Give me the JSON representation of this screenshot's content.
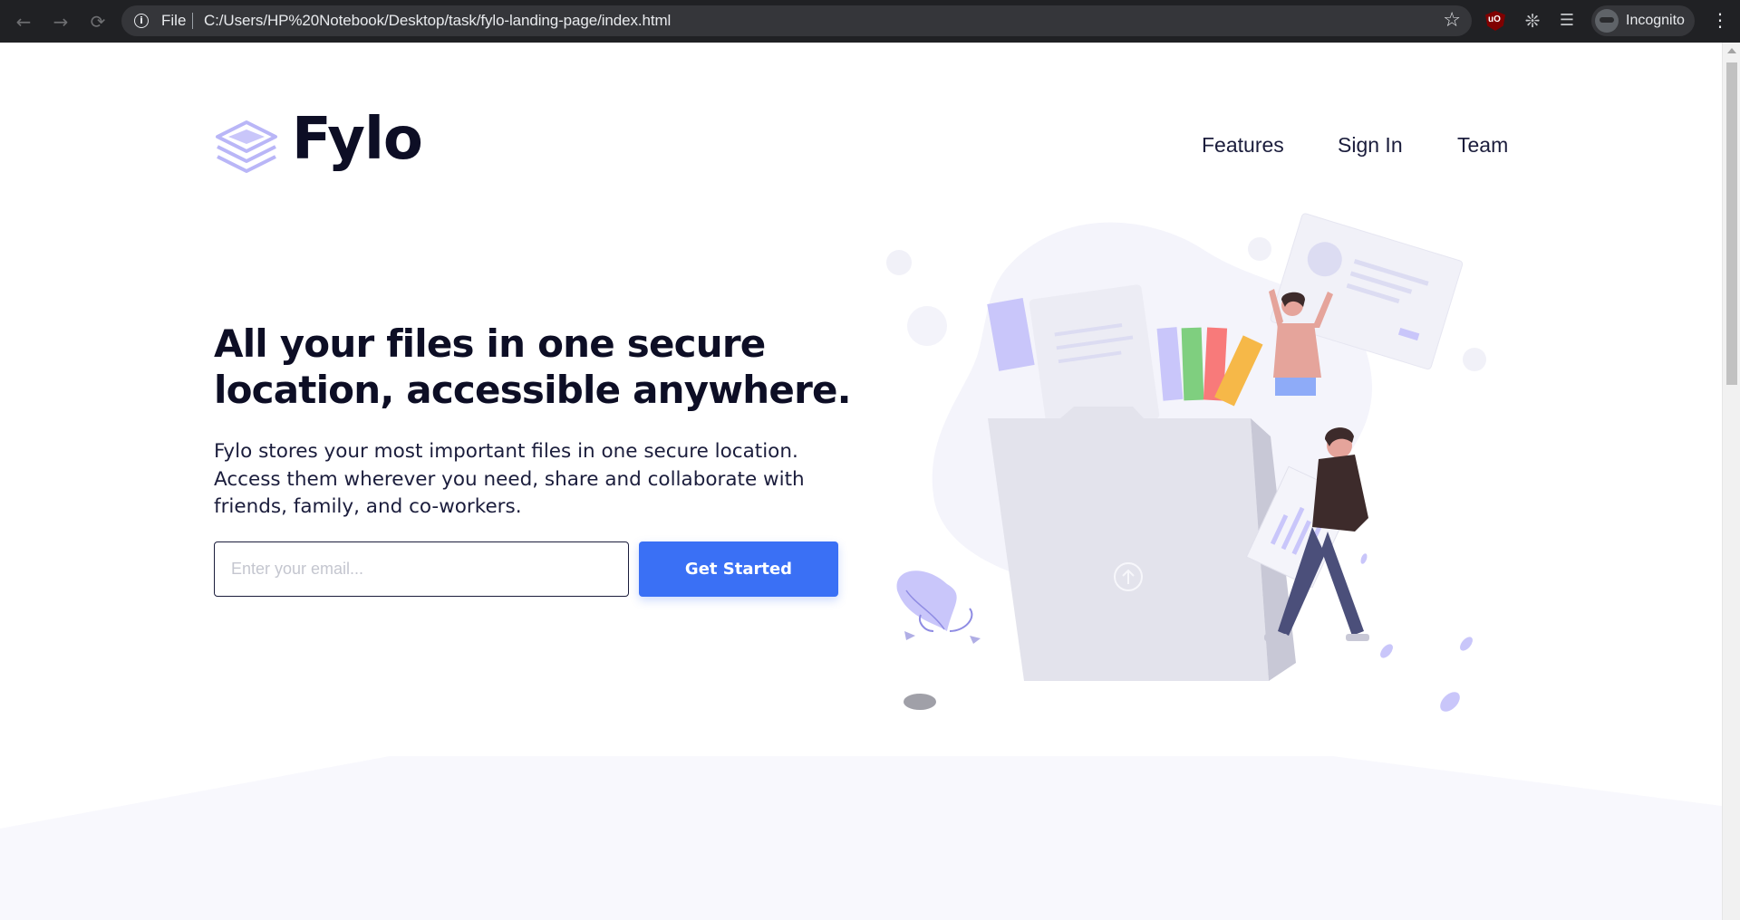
{
  "browser": {
    "file_label": "File",
    "url": "C:/Users/HP%20Notebook/Desktop/task/fylo-landing-page/index.html",
    "profile_label": "Incognito",
    "icons": [
      "back-icon",
      "forward-icon",
      "reload-icon",
      "info-icon",
      "star-icon",
      "ublock-icon",
      "puzzle-icon",
      "media-icon",
      "incognito-icon",
      "kebab-icon"
    ]
  },
  "header": {
    "logo_text": "Fylo",
    "nav": [
      "Features",
      "Sign In",
      "Team"
    ]
  },
  "hero": {
    "headline_line1": "All your files in one secure",
    "headline_line2": "location, accessible anywhere.",
    "body": "Fylo stores your most important files in one secure location. Access them wherever you need, share and collaborate with friends, family, and co-workers.",
    "email_placeholder": "Enter your email...",
    "cta_label": "Get Started"
  },
  "colors": {
    "heading": "#0d0e25",
    "text": "#1b1d3c",
    "accent_blue": "#3a70f5",
    "logo_purple": "#b9b6f7",
    "band": "#f8f8fd"
  }
}
